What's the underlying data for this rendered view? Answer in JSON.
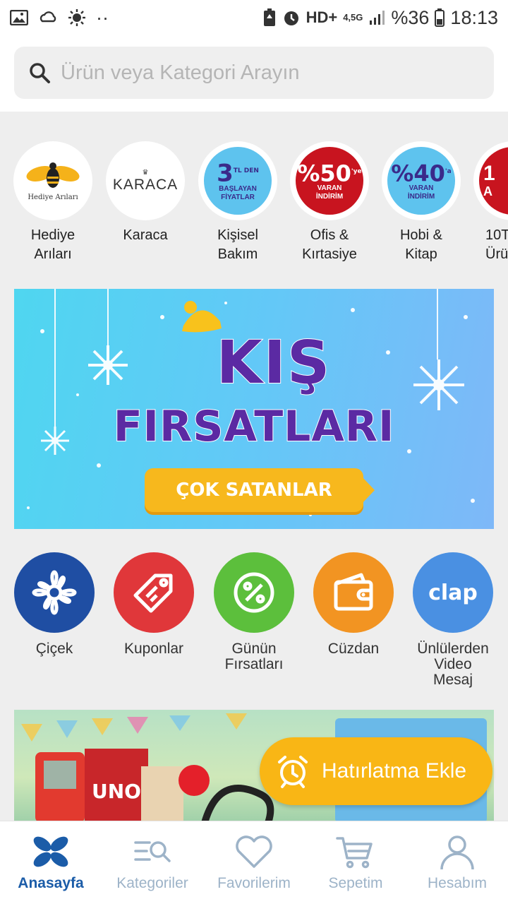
{
  "status_bar": {
    "network": "HD+",
    "network_type": "4,5G",
    "battery": "%36",
    "time": "18:13"
  },
  "search": {
    "placeholder": "Ürün veya Kategori Arayın"
  },
  "categories": [
    {
      "label": "Hediye\nArıları",
      "logo": "Hediye Arıları"
    },
    {
      "label": "Karaca",
      "logo": "KARACA"
    },
    {
      "label": "Kişisel\nBakım",
      "badge_top": "3",
      "badge_sup": "TL DEN",
      "badge_bottom": "BAŞLAYAN FİYATLAR"
    },
    {
      "label": "Ofis &\nKırtasiye",
      "badge_top": "%50",
      "badge_sup": "'ye",
      "badge_bottom": "VARAN İNDİRİM"
    },
    {
      "label": "Hobi &\nKitap",
      "badge_top": "%40",
      "badge_sup": "'a",
      "badge_bottom": "VARAN İNDİRİM"
    },
    {
      "label": "10T\nÜrü",
      "badge_top": "1",
      "badge_bottom": "A"
    }
  ],
  "banner": {
    "title_line1": "KIŞ",
    "title_line2": "FIRSATLARI",
    "button": "ÇOK SATANLAR"
  },
  "shortcuts": [
    {
      "label": "Çiçek",
      "color": "#1f4ea3",
      "icon": "flower-icon"
    },
    {
      "label": "Kuponlar",
      "color": "#e0373a",
      "icon": "tag-icon"
    },
    {
      "label": "Günün\nFırsatları",
      "color": "#5cbf3c",
      "icon": "percent-icon"
    },
    {
      "label": "Cüzdan",
      "color": "#f29422",
      "icon": "wallet-icon"
    },
    {
      "label": "Ünlülerden\nVideo\nMesaj",
      "color": "#4a90e2",
      "icon": "clap-logo",
      "logo_text": "clap"
    }
  ],
  "reminder": {
    "label": "Hatırlatma Ekle",
    "icon": "alarm-clock-icon"
  },
  "bottom_nav": [
    {
      "label": "Anasayfa",
      "icon": "home-flower-icon",
      "active": true
    },
    {
      "label": "Kategoriler",
      "icon": "category-search-icon",
      "active": false
    },
    {
      "label": "Favorilerim",
      "icon": "heart-icon",
      "active": false
    },
    {
      "label": "Sepetim",
      "icon": "cart-icon",
      "active": false
    },
    {
      "label": "Hesabım",
      "icon": "user-icon",
      "active": false
    }
  ]
}
